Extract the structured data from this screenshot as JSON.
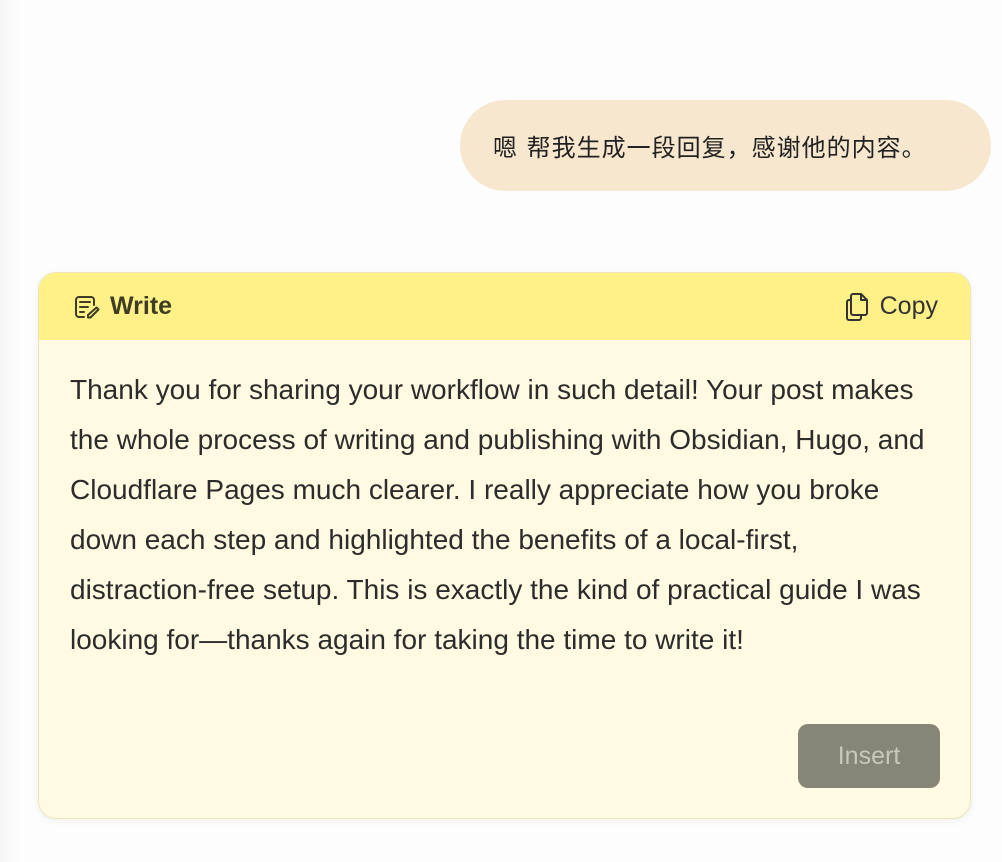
{
  "conversation": {
    "user_message": "嗯 帮我生成一段回复，感谢他的内容。"
  },
  "assistant_card": {
    "header": {
      "write_label": "Write",
      "write_icon": "write-icon",
      "copy_label": "Copy",
      "copy_icon": "copy-icon"
    },
    "body_text": "Thank you for sharing your workflow in such detail! Your post makes the whole process of writing and publishing with Obsidian, Hugo, and Cloudflare Pages much clearer. I really appreciate how you broke down each step and highlighted the benefits of a local-first, distraction-free setup. This is exactly the kind of practical guide I was looking for—thanks again for taking the time to write it!",
    "insert_label": "Insert"
  },
  "colors": {
    "user_bubble": "#f8e7cf",
    "card_header": "#fff187",
    "card_body": "#fffae1",
    "insert_button": "#868677"
  }
}
